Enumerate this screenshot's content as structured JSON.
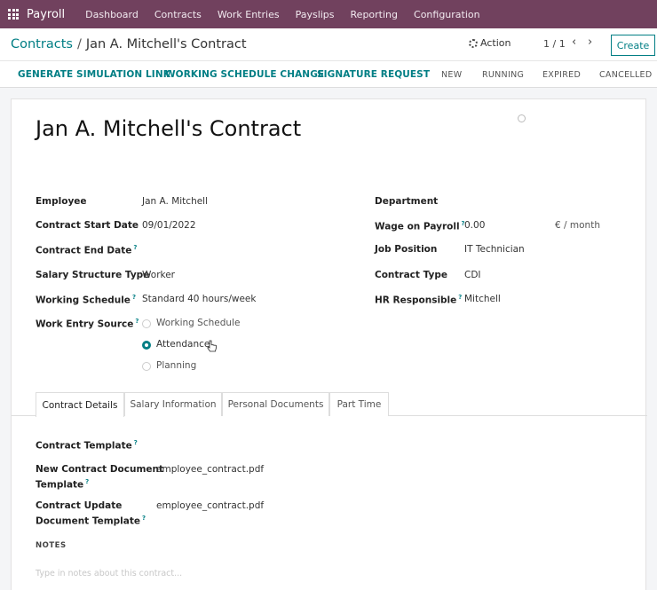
{
  "topnav": {
    "app_name": "Payroll",
    "items": [
      "Dashboard",
      "Contracts",
      "Work Entries",
      "Payslips",
      "Reporting",
      "Configuration"
    ]
  },
  "control": {
    "breadcrumb_parent": "Contracts",
    "breadcrumb_sep": "/",
    "breadcrumb_current": "Jan A. Mitchell's Contract",
    "action_label": "Action",
    "pager": "1 / 1",
    "prev": "‹",
    "next": "›",
    "create_label": "Create"
  },
  "statusbar": {
    "buttons": [
      "GENERATE SIMULATION LINK",
      "WORKING SCHEDULE CHANGE",
      "SIGNATURE REQUEST"
    ],
    "stages": [
      "NEW",
      "RUNNING",
      "EXPIRED",
      "CANCELLED"
    ]
  },
  "form": {
    "title": "Jan A. Mitchell's Contract",
    "left": {
      "employee_label": "Employee",
      "employee": "Jan A. Mitchell",
      "start_label": "Contract Start Date",
      "start": "09/01/2022",
      "end_label": "Contract End Date",
      "structure_label": "Salary Structure Type",
      "structure": "Worker",
      "schedule_label": "Working Schedule",
      "schedule": "Standard 40 hours/week",
      "source_label": "Work Entry Source",
      "source_options": [
        "Working Schedule",
        "Attendance",
        "Planning"
      ]
    },
    "right": {
      "department_label": "Department",
      "wage_label": "Wage on Payroll",
      "wage": "0.00",
      "wage_unit": "€ / month",
      "job_label": "Job Position",
      "job": "IT Technician",
      "contract_type_label": "Contract Type",
      "contract_type": "CDI",
      "hr_label": "HR Responsible",
      "hr": "Mitchell"
    },
    "tip_mark": "?",
    "tabs": [
      "Contract Details",
      "Salary Information",
      "Personal Documents",
      "Part Time"
    ],
    "details": {
      "template_label": "Contract Template",
      "new_doc_label_1": "New Contract Document",
      "new_doc_label_2": "Template",
      "new_doc": "employee_contract.pdf",
      "update_doc_label_1": "Contract Update",
      "update_doc_label_2": "Document Template",
      "update_doc": "employee_contract.pdf",
      "notes_heading": "NOTES",
      "notes_placeholder": "Type in notes about this contract..."
    }
  },
  "colors": {
    "nav_bg": "#71415e",
    "accent": "#017e84"
  }
}
